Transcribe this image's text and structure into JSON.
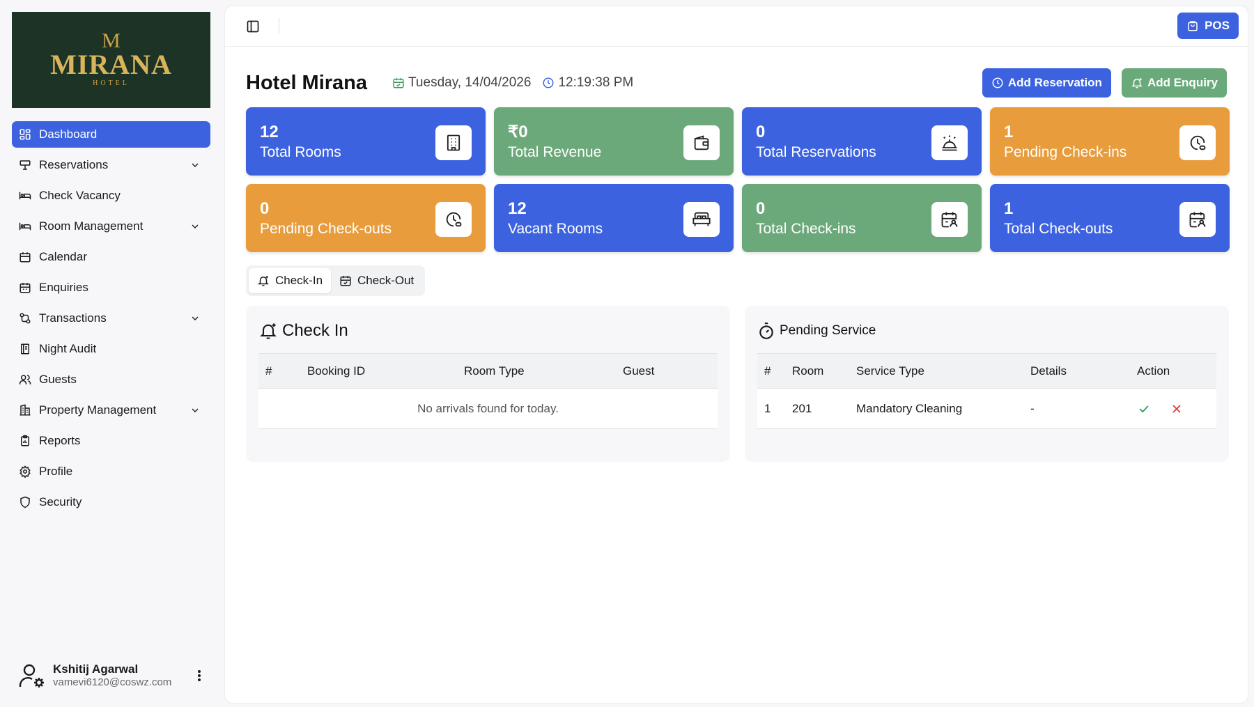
{
  "logo": {
    "mark": "M",
    "name": "MIRANA",
    "sub": "HOTEL"
  },
  "sidebar": {
    "items": [
      {
        "label": "Dashboard",
        "icon": "dashboard-icon",
        "active": true
      },
      {
        "label": "Reservations",
        "icon": "reservations-icon",
        "expandable": true
      },
      {
        "label": "Check Vacancy",
        "icon": "bed-icon"
      },
      {
        "label": "Room Management",
        "icon": "bed-icon",
        "expandable": true
      },
      {
        "label": "Calendar",
        "icon": "calendar-icon"
      },
      {
        "label": "Enquiries",
        "icon": "calendar-icon"
      },
      {
        "label": "Transactions",
        "icon": "transactions-icon",
        "expandable": true
      },
      {
        "label": "Night Audit",
        "icon": "book-icon"
      },
      {
        "label": "Guests",
        "icon": "users-icon"
      },
      {
        "label": "Property Management",
        "icon": "building-icon",
        "expandable": true
      },
      {
        "label": "Reports",
        "icon": "clipboard-icon"
      },
      {
        "label": "Profile",
        "icon": "gear-icon"
      },
      {
        "label": "Security",
        "icon": "shield-icon"
      }
    ]
  },
  "user": {
    "name": "Kshitij Agarwal",
    "email": "vamevi6120@coswz.com"
  },
  "topbar": {
    "pos_label": "POS"
  },
  "header": {
    "title": "Hotel Mirana",
    "date": "Tuesday, 14/04/2026",
    "time": "12:19:38 PM",
    "add_reservation": "Add Reservation",
    "add_enquiry": "Add Enquiry"
  },
  "cards": [
    {
      "value": "12",
      "label": "Total Rooms",
      "color": "#3c62e0"
    },
    {
      "value": "₹0",
      "label": "Total Revenue",
      "color": "#6ba97a"
    },
    {
      "value": "0",
      "label": "Total Reservations",
      "color": "#3c62e0"
    },
    {
      "value": "1",
      "label": "Pending Check-ins",
      "color": "#e89c3c"
    },
    {
      "value": "0",
      "label": "Pending Check-outs",
      "color": "#e89c3c"
    },
    {
      "value": "12",
      "label": "Vacant Rooms",
      "color": "#3c62e0"
    },
    {
      "value": "0",
      "label": "Total Check-ins",
      "color": "#6ba97a"
    },
    {
      "value": "1",
      "label": "Total Check-outs",
      "color": "#3c62e0"
    }
  ],
  "tabs": {
    "checkin": "Check-In",
    "checkout": "Check-Out"
  },
  "checkin_panel": {
    "title": "Check In",
    "columns": [
      "#",
      "Booking ID",
      "Room Type",
      "Guest"
    ],
    "empty": "No arrivals found for today."
  },
  "service_panel": {
    "title": "Pending Service",
    "columns": [
      "#",
      "Room",
      "Service Type",
      "Details",
      "Action"
    ],
    "rows": [
      {
        "num": "1",
        "room": "201",
        "service": "Mandatory Cleaning",
        "details": "-"
      }
    ]
  }
}
